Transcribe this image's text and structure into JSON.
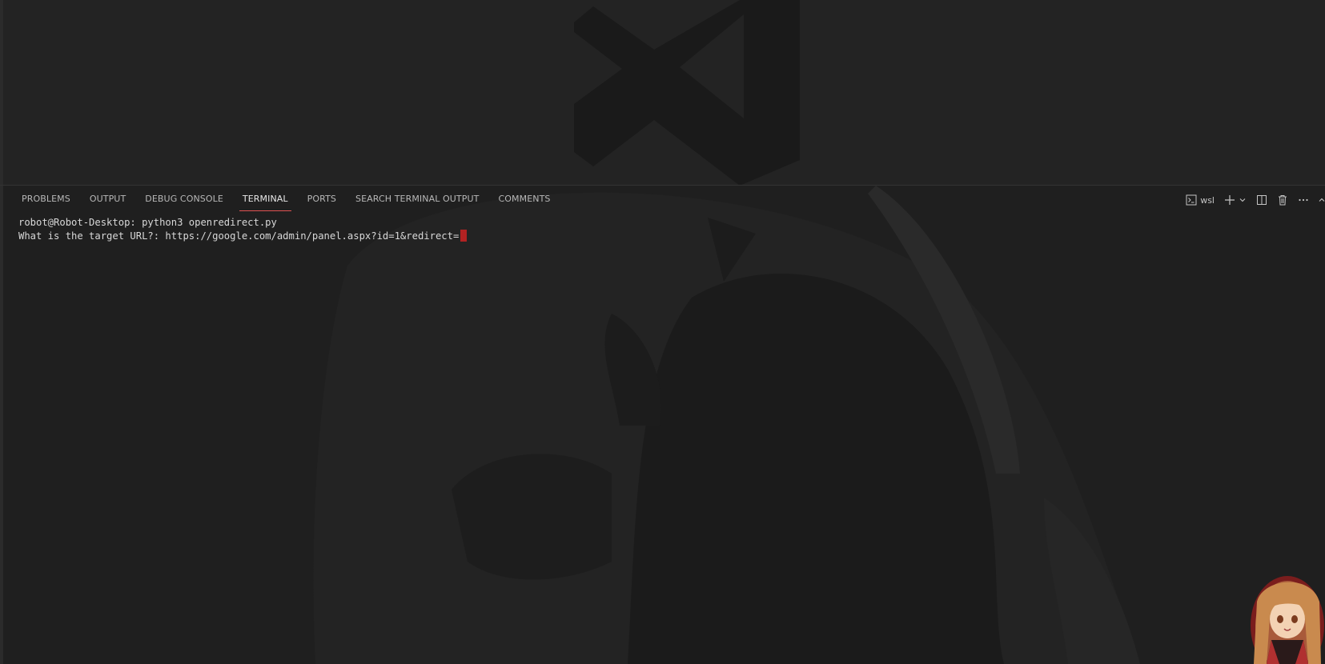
{
  "panel": {
    "tabs": [
      {
        "label": "PROBLEMS",
        "active": false
      },
      {
        "label": "OUTPUT",
        "active": false
      },
      {
        "label": "DEBUG CONSOLE",
        "active": false
      },
      {
        "label": "TERMINAL",
        "active": true
      },
      {
        "label": "PORTS",
        "active": false
      },
      {
        "label": "SEARCH TERMINAL OUTPUT",
        "active": false
      },
      {
        "label": "COMMENTS",
        "active": false
      }
    ],
    "actions": {
      "terminal_profile_label": "wsl",
      "new_terminal_icon": "plus-icon",
      "dropdown_icon": "chevron-down-icon",
      "split_icon": "split-terminal-icon",
      "kill_icon": "trash-icon",
      "more_icon": "ellipsis-icon",
      "maximize_icon": "chevron-up-icon"
    }
  },
  "terminal": {
    "lines": [
      "robot@Robot-Desktop: python3 openredirect.py",
      "What is the target URL?: https://google.com/admin/panel.aspx?id=1&redirect="
    ],
    "cursor_color": "#b22222"
  },
  "colors": {
    "accent": "#e05252",
    "background": "#1e1e1e"
  }
}
